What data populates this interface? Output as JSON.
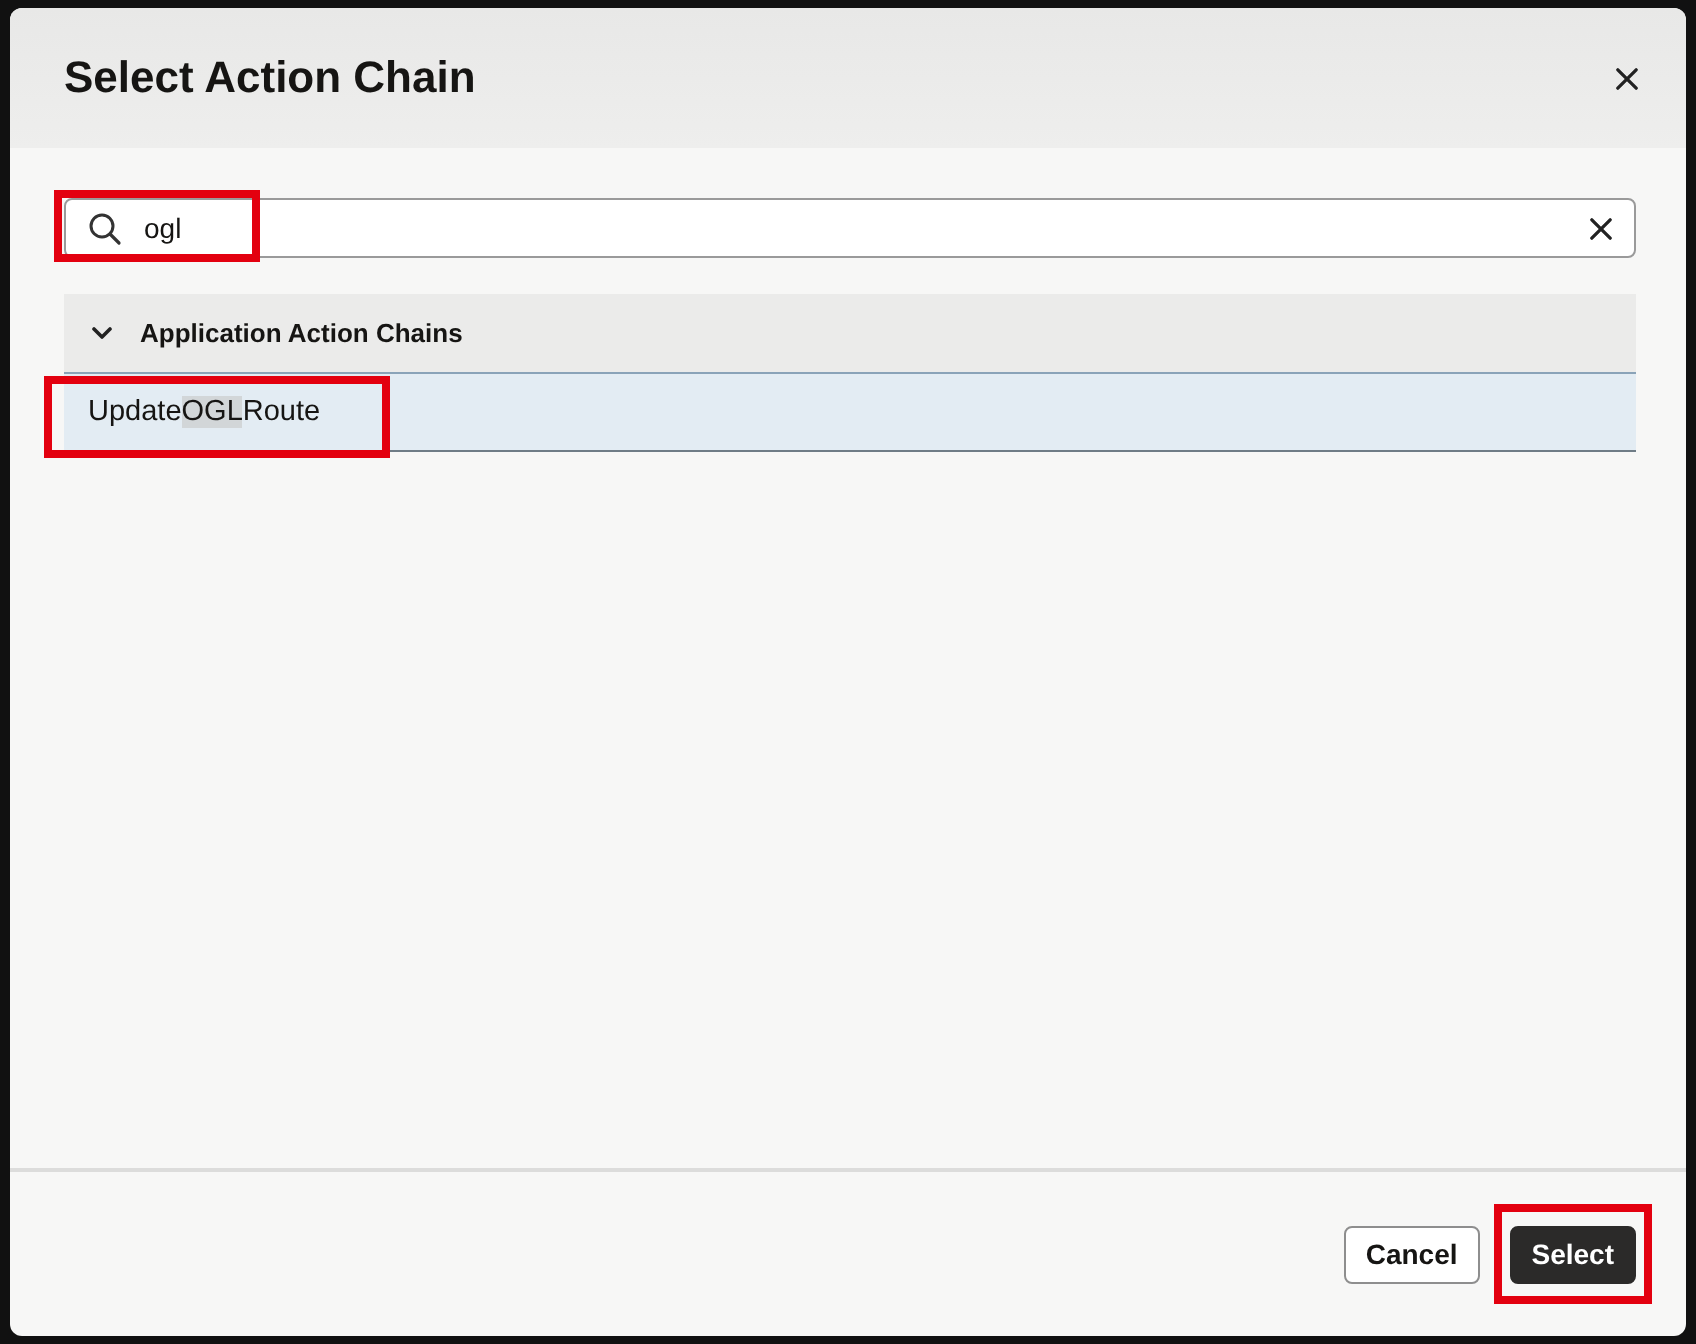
{
  "dialog": {
    "title": "Select Action Chain"
  },
  "search": {
    "value": "ogl",
    "highlighted": true
  },
  "groups": [
    {
      "label": "Application Action Chains",
      "expanded": true,
      "items": [
        {
          "label_parts": [
            {
              "text": "Update",
              "matched": false
            },
            {
              "text": "OGL",
              "matched": true
            },
            {
              "text": "Route",
              "matched": false
            }
          ],
          "selected": true,
          "highlighted": true
        }
      ]
    }
  ],
  "buttons": [
    {
      "label": "Cancel",
      "kind": "secondary",
      "highlighted": false
    },
    {
      "label": "Select",
      "kind": "primary",
      "highlighted": true
    }
  ]
}
